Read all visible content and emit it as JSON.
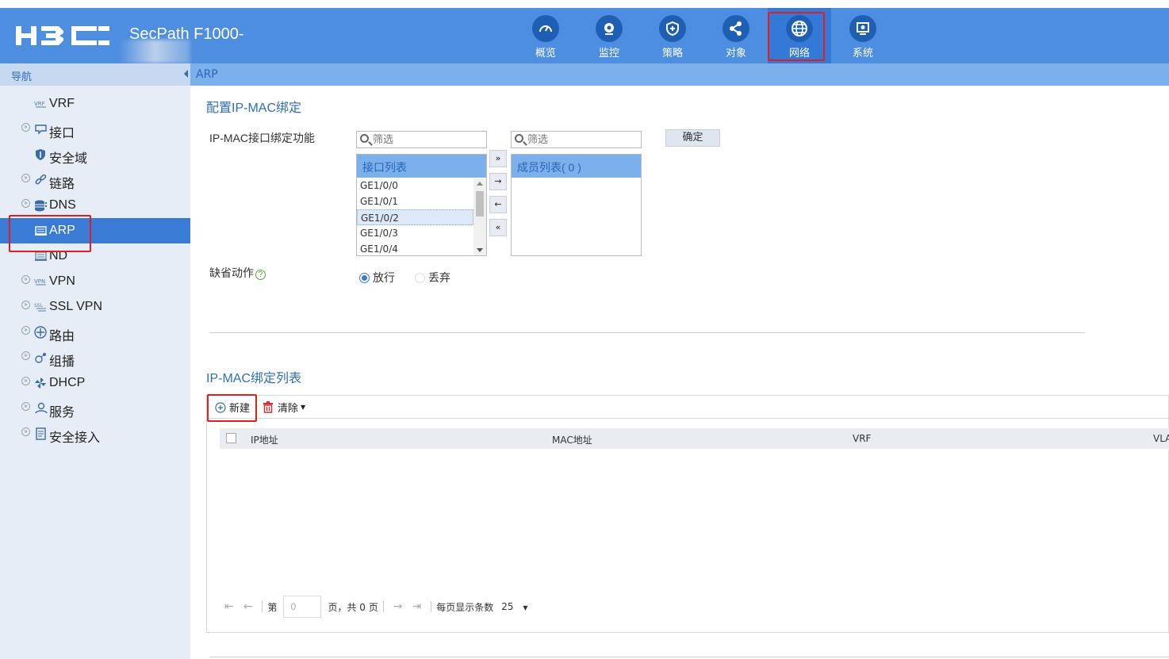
{
  "app": {
    "product_name": "SecPath F1000-"
  },
  "top_nav": [
    {
      "label": "概览",
      "icon": "dashboard-icon"
    },
    {
      "label": "监控",
      "icon": "monitor-icon"
    },
    {
      "label": "策略",
      "icon": "shield-icon"
    },
    {
      "label": "对象",
      "icon": "share-icon"
    },
    {
      "label": "网络",
      "icon": "globe-icon",
      "active": true
    },
    {
      "label": "系统",
      "icon": "system-icon"
    }
  ],
  "sidebar": {
    "header": "导航",
    "items": [
      {
        "label": "VRF",
        "icon": "vrf-icon",
        "expandable": false
      },
      {
        "label": "接口",
        "icon": "interface-icon",
        "expandable": true
      },
      {
        "label": "安全域",
        "icon": "security-zone-icon",
        "expandable": false
      },
      {
        "label": "链路",
        "icon": "link-icon",
        "expandable": true
      },
      {
        "label": "DNS",
        "icon": "dns-icon",
        "expandable": true
      },
      {
        "label": "ARP",
        "icon": "arp-icon",
        "expandable": false,
        "active": true
      },
      {
        "label": "ND",
        "icon": "nd-icon",
        "expandable": false
      },
      {
        "label": "VPN",
        "icon": "vpn-icon",
        "expandable": true
      },
      {
        "label": "SSL VPN",
        "icon": "ssl-vpn-icon",
        "expandable": true
      },
      {
        "label": "路由",
        "icon": "routing-icon",
        "expandable": true
      },
      {
        "label": "组播",
        "icon": "multicast-icon",
        "expandable": true
      },
      {
        "label": "DHCP",
        "icon": "dhcp-icon",
        "expandable": true
      },
      {
        "label": "服务",
        "icon": "service-icon",
        "expandable": true
      },
      {
        "label": "安全接入",
        "icon": "secure-access-icon",
        "expandable": true
      }
    ]
  },
  "breadcrumb": "ARP",
  "config": {
    "title": "配置IP-MAC绑定",
    "binding_label": "IP-MAC接口绑定功能",
    "filter_placeholder": "筛选",
    "interface_list_header": "接口列表",
    "interfaces": [
      "GE1/0/0",
      "GE1/0/1",
      "GE1/0/2",
      "GE1/0/3",
      "GE1/0/4"
    ],
    "selected_interface": "GE1/0/2",
    "member_list_header": "成员列表( 0 )",
    "ok_label": "确定",
    "default_action_label": "缺省动作",
    "help_glyph": "?",
    "actions": [
      {
        "label": "放行",
        "checked": true
      },
      {
        "label": "丢弃",
        "checked": false
      }
    ]
  },
  "binding_list": {
    "title": "IP-MAC绑定列表",
    "new_label": "新建",
    "clear_label": "清除",
    "columns": [
      "IP地址",
      "MAC地址",
      "VRF",
      "VLA"
    ],
    "pager": {
      "page_prefix": "第",
      "page_value": "0",
      "page_suffix": "页，共 0 页",
      "per_page_label": "每页显示条数",
      "per_page_value": "25"
    }
  },
  "colors": {
    "header_bg": "#4d8ee0",
    "accent": "#3a7bd5",
    "highlight_box": "#e02020"
  }
}
